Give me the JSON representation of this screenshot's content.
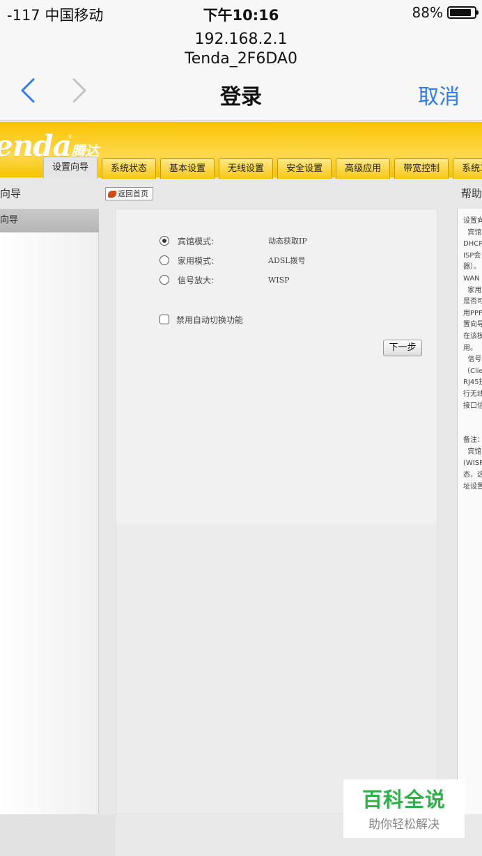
{
  "status_bar": {
    "carrier": "-117 中国移动",
    "time": "下午10:16",
    "battery": "88%",
    "battery_level": 0.88
  },
  "nav": {
    "host": "192.168.2.1",
    "ssid": "Tenda_2F6DA0",
    "title": "登录",
    "cancel_label": "取消",
    "back_icon": "chevron-left-icon",
    "forward_icon": "chevron-right-icon",
    "accent": "#2f7cf6"
  },
  "router": {
    "logo": "enda",
    "logo_cn": "腾达",
    "logo_reg": "®",
    "tabs": [
      "设置向导",
      "系统状态",
      "基本设置",
      "无线设置",
      "安全设置",
      "高级应用",
      "带宽控制",
      "系统工"
    ],
    "active_tab": 0,
    "left_title": "向导",
    "left_item": "向导",
    "back_home_label": "返回首页",
    "help_title": "帮助",
    "modes": [
      {
        "label": "宾馆模式:",
        "value": "动态获取IP",
        "checked": true
      },
      {
        "label": "家用模式:",
        "value": "ADSL拨号",
        "checked": false
      },
      {
        "label": "信号放大:",
        "value": "WISP",
        "checked": false
      }
    ],
    "auto_switch_label": "禁用自动切换功能",
    "next_label": "下一步",
    "help_text": "设置向\n  宾馆\nDHCP\nISP会\n器）。\nWAN\n  家用\n是否可\n用PPP\n置向导\n在该模\n用。\n  信号\n（Clie\nRJ45接\n行无线\n接口信\n\n\n备注：\n  宾馆\n(WISP\n态，这\n址设置",
    "brand_color": "#f7c300"
  },
  "watermark": {
    "title": "百科全说",
    "subtitle": "助你轻松解决"
  }
}
